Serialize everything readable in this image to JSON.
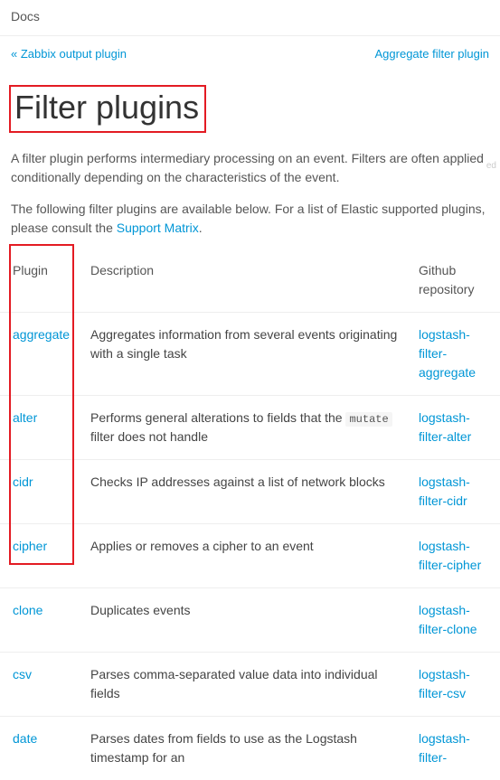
{
  "topbar": {
    "label": "Docs"
  },
  "nav": {
    "prev_prefix": "«",
    "prev_label": "Zabbix output plugin",
    "next_label": "Aggregate filter plugin"
  },
  "page": {
    "title": "Filter plugins",
    "edit_hint": "ed",
    "intro": "A filter plugin performs intermediary processing on an event. Filters are often applied conditionally depending on the characteristics of the event.",
    "list_lead": "The following filter plugins are available below. For a list of Elastic supported plugins, please consult the ",
    "list_lead_link": "Support Matrix",
    "list_lead_tail": "."
  },
  "table": {
    "headers": {
      "plugin": "Plugin",
      "description": "Description",
      "repo": "Github repository"
    },
    "rows": [
      {
        "plugin": "aggregate",
        "desc": "Aggregates information from several events originating with a single task",
        "repo": "logstash-filter-aggregate"
      },
      {
        "plugin": "alter",
        "desc_pre": "Performs general alterations to fields that the ",
        "desc_code": "mutate",
        "desc_post": " filter does not handle",
        "repo": "logstash-filter-alter"
      },
      {
        "plugin": "cidr",
        "desc": "Checks IP addresses against a list of network blocks",
        "repo": "logstash-filter-cidr"
      },
      {
        "plugin": "cipher",
        "desc": "Applies or removes a cipher to an event",
        "repo": "logstash-filter-cipher"
      },
      {
        "plugin": "clone",
        "desc": "Duplicates events",
        "repo": "logstash-filter-clone"
      },
      {
        "plugin": "csv",
        "desc": "Parses comma-separated value data into individual fields",
        "repo": "logstash-filter-csv"
      },
      {
        "plugin": "date",
        "desc": "Parses dates from fields to use as the Logstash timestamp for an",
        "repo": "logstash-filter-"
      }
    ]
  }
}
